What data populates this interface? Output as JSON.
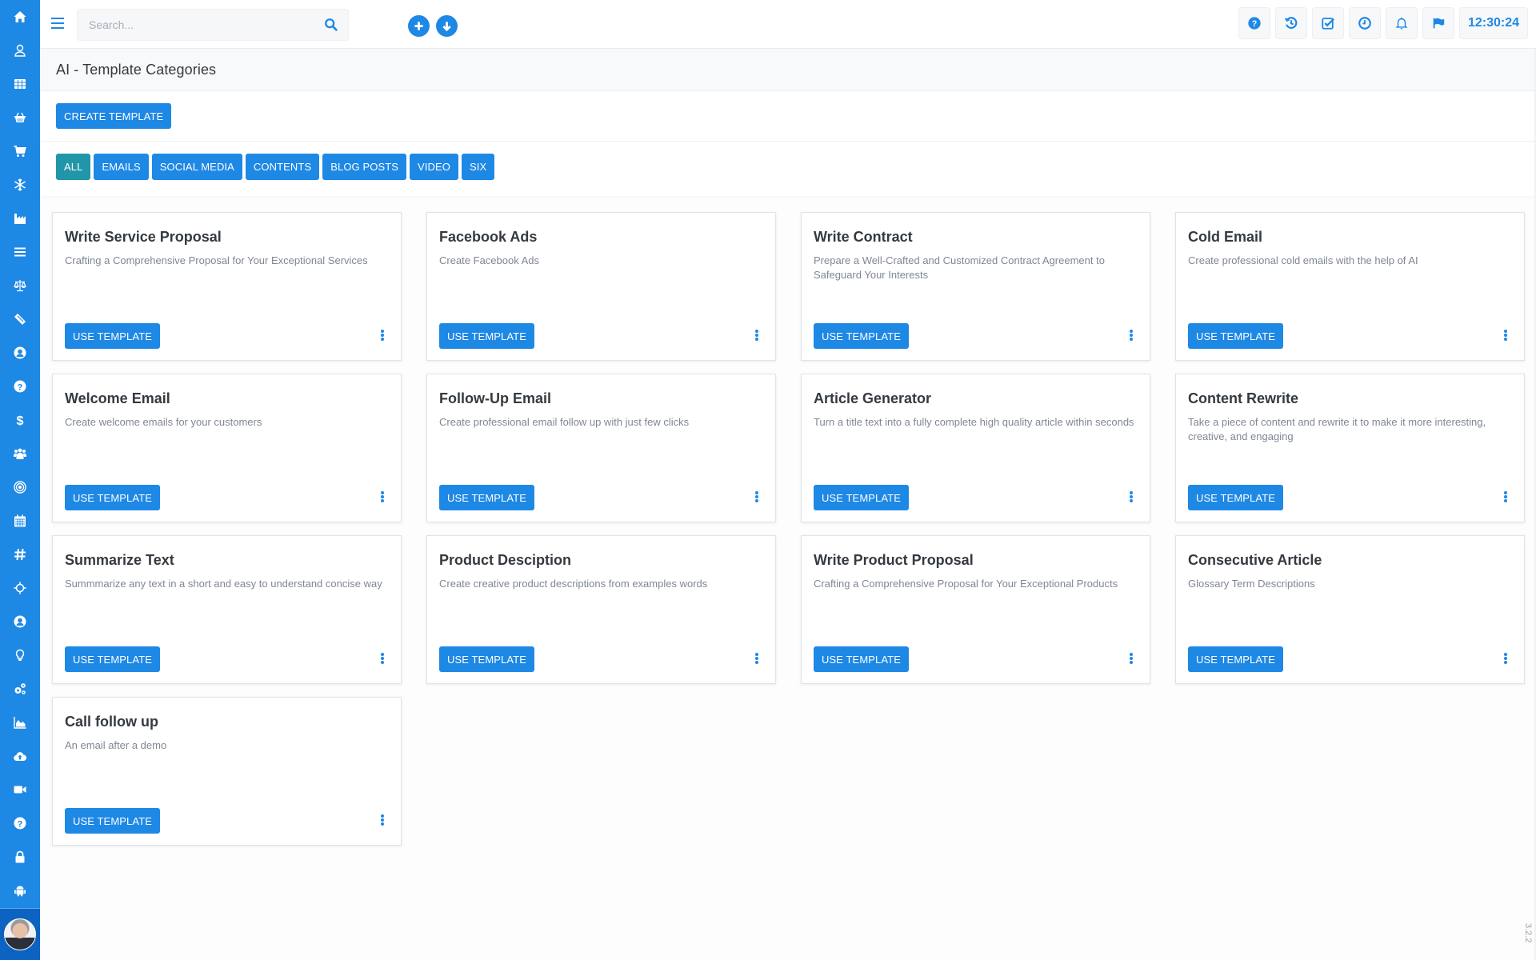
{
  "sidebar": {
    "items": [
      {
        "icon": "home-icon",
        "label": "Home"
      },
      {
        "icon": "user-icon",
        "label": "Users"
      },
      {
        "icon": "table-icon",
        "label": "Tables"
      },
      {
        "icon": "basket-icon",
        "label": "Basket"
      },
      {
        "icon": "cart-icon",
        "label": "Cart"
      },
      {
        "icon": "snowflake-icon",
        "label": "Snowflake"
      },
      {
        "icon": "factory-icon",
        "label": "Industry"
      },
      {
        "icon": "list-icon",
        "label": "List"
      },
      {
        "icon": "scale-icon",
        "label": "Legal"
      },
      {
        "icon": "ticket-icon",
        "label": "Tickets"
      },
      {
        "icon": "user-circle-icon",
        "label": "Profile"
      },
      {
        "icon": "help-icon",
        "label": "Help"
      },
      {
        "icon": "dollar-icon",
        "label": "Finance"
      },
      {
        "icon": "users-icon",
        "label": "Teams"
      },
      {
        "icon": "target-icon",
        "label": "Targets"
      },
      {
        "icon": "calendar-icon",
        "label": "Calendar"
      },
      {
        "icon": "hashtag-icon",
        "label": "Tags"
      },
      {
        "icon": "crosshair-icon",
        "label": "Tracking"
      },
      {
        "icon": "user-circle-icon",
        "label": "Account"
      },
      {
        "icon": "lightbulb-icon",
        "label": "Ideas"
      },
      {
        "icon": "gears-icon",
        "label": "Settings"
      },
      {
        "icon": "area-chart-icon",
        "label": "Reports"
      },
      {
        "icon": "cloud-upload-icon",
        "label": "Upload"
      },
      {
        "icon": "video-icon",
        "label": "Video"
      },
      {
        "icon": "help-icon",
        "label": "Support"
      },
      {
        "icon": "lock-icon",
        "label": "Security"
      },
      {
        "icon": "android-icon",
        "label": "Android"
      }
    ]
  },
  "header": {
    "search_placeholder": "Search...",
    "clock": "12:30:24"
  },
  "page": {
    "title": "AI - Template Categories",
    "create_label": "CREATE TEMPLATE"
  },
  "filters": [
    {
      "label": "ALL",
      "active": true
    },
    {
      "label": "EMAILS",
      "active": false
    },
    {
      "label": "SOCIAL MEDIA",
      "active": false
    },
    {
      "label": "CONTENTS",
      "active": false
    },
    {
      "label": "BLOG POSTS",
      "active": false
    },
    {
      "label": "VIDEO",
      "active": false
    },
    {
      "label": "SIX",
      "active": false
    }
  ],
  "use_label": "USE TEMPLATE",
  "templates": [
    {
      "title": "Write Service Proposal",
      "desc": "Crafting a Comprehensive Proposal for Your Exceptional Services"
    },
    {
      "title": "Facebook Ads",
      "desc": "Create Facebook Ads"
    },
    {
      "title": "Write Contract",
      "desc": "Prepare a Well-Crafted and Customized Contract Agreement to Safeguard Your Interests"
    },
    {
      "title": "Cold Email",
      "desc": "Create professional cold emails with the help of AI"
    },
    {
      "title": "Welcome Email",
      "desc": "Create welcome emails for your customers"
    },
    {
      "title": "Follow-Up Email",
      "desc": "Create professional email follow up with just few clicks"
    },
    {
      "title": "Article Generator",
      "desc": "Turn a title text into a fully complete high quality article within seconds"
    },
    {
      "title": "Content Rewrite",
      "desc": "Take a piece of content and rewrite it to make it more interesting, creative, and engaging"
    },
    {
      "title": "Summarize Text",
      "desc": "Summmarize any text in a short and easy to understand concise way"
    },
    {
      "title": "Product Desciption",
      "desc": "Create creative product descriptions from examples words"
    },
    {
      "title": "Write Product Proposal",
      "desc": "Crafting a Comprehensive Proposal for Your Exceptional Products"
    },
    {
      "title": "Consecutive Article",
      "desc": "Glossary Term Descriptions"
    },
    {
      "title": "Call follow up",
      "desc": "An email after a demo"
    }
  ],
  "version": "3.2.2",
  "colors": {
    "primary": "#1e88e5",
    "active_filter": "#2196a8",
    "sidebar_bottom": "#0d63c2"
  }
}
